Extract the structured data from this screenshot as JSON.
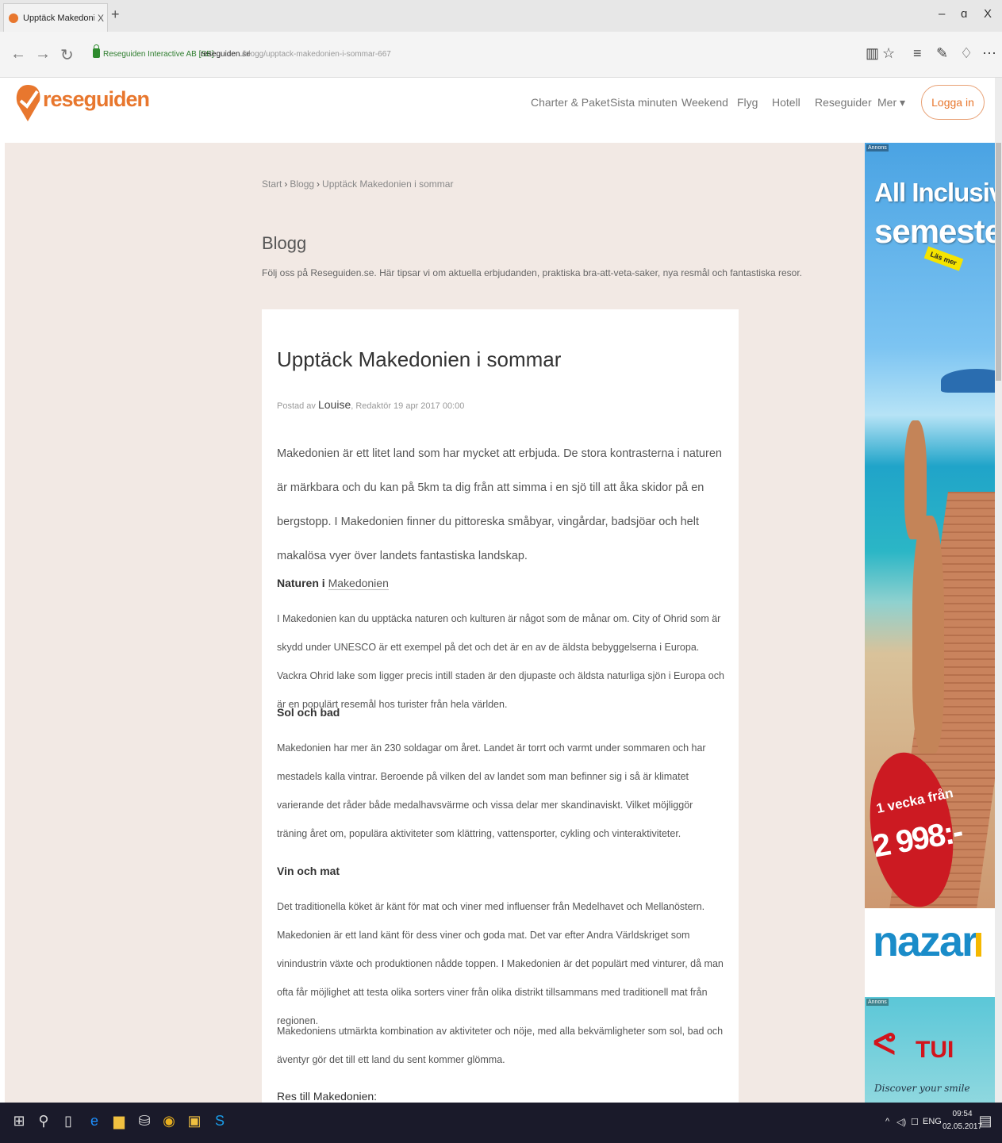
{
  "browser": {
    "tab_title": "Upptäck Makedonien i :",
    "tab_close": "X",
    "new_tab": "+",
    "window_minimize": "–",
    "window_restore": "ɑ",
    "window_close": "X",
    "site_identity": "Reseguiden Interactive AB [SE]",
    "url_host": "reseguiden.se",
    "url_path": "/blogg/upptack-makedonien-i-sommar-667"
  },
  "site": {
    "logo_text": "reseguiden",
    "nav": [
      "Charter & Paket",
      "Sista minuten",
      "Weekend",
      "Flyg",
      "Hotell",
      "Reseguider",
      "Mer ▾"
    ],
    "login_label": "Logga in"
  },
  "breadcrumb": [
    "Start",
    "Blogg",
    "Upptäck Makedonien i sommar"
  ],
  "blog": {
    "title": "Blogg",
    "subtitle": "Följ oss på Reseguiden.se. Här tipsar vi om aktuella erbjudanden, praktiska bra-att-veta-saker, nya resmål och fantastiska resor."
  },
  "article": {
    "title": "Upptäck Makedonien i sommar",
    "posted_by": "Postad av",
    "author": "Louise",
    "author_role_date": ", Redaktör 19 apr 2017 00:00",
    "intro": "Makedonien är ett litet land som har mycket att erbjuda. De stora kontrasterna i naturen är märkbara och du kan på 5km ta dig från att simma i en sjö till att åka skidor på en bergstopp. I Makedonien finner du pittoreska småbyar, vingårdar, badsjöar och helt makalösa vyer över landets fantastiska landskap.",
    "section1_title_a": "Naturen i ",
    "section1_title_b": "Makedonien",
    "section1_text": "I Makedonien kan du upptäcka naturen och kulturen är något som de månar om. City of Ohrid som är skydd under UNESCO är ett exempel på det och det är en av de äldsta bebyggelserna i Europa. Vackra Ohrid lake som ligger precis intill staden är den djupaste och äldsta naturliga sjön i Europa och är en populärt resemål hos turister från hela världen.",
    "section2_title": "Sol och bad",
    "section2_text": "Makedonien har mer än 230 soldagar om året. Landet är torrt och varmt under sommaren och har mestadels kalla vintrar. Beroende på vilken del av landet som man befinner sig i så är klimatet varierande det råder både medalhavsvärme och vissa delar mer skandinaviskt. Vilket möjliggör träning året om, populära aktiviteter som klättring, vattensporter, cykling och vinteraktiviteter.",
    "section3_title": "Vin och mat",
    "section3_text": "Det traditionella köket är känt för mat och viner med influenser från Medelhavet och Mellanöstern. Makedonien är ett land känt för dess viner och goda mat. Det var efter Andra Världskriget som vinindustrin växte och produktionen nådde toppen. I Makedonien är det populärt med vinturer, då man ofta får möjlighet att testa olika sorters viner från olika distrikt tillsammans med traditionell mat från regionen.",
    "closing_text": "Makedoniens utmärkta kombination av aktiviteter och nöje, med alla bekvämligheter som sol, bad och äventyr gör det till ett land du sent kommer glömma.",
    "section4_title": "Res till Makedonien:"
  },
  "ads": {
    "label": "Annons",
    "headline1": "All Inclusive-",
    "headline2": "semester",
    "read_more": "Läs mer",
    "offer_text": "1 vecka från",
    "price": "2 998:-",
    "brand": "nazar",
    "ad2_brand": "TUI",
    "ad2_tagline": "Discover your smile"
  },
  "taskbar": {
    "language": "ENG",
    "time": "09:54",
    "date": "02.05.2017"
  },
  "colors": {
    "brand_orange": "#e8772e",
    "page_bg": "#f2e9e4",
    "nazar_blue": "#1a8cc9",
    "tui_red": "#d2141c"
  }
}
